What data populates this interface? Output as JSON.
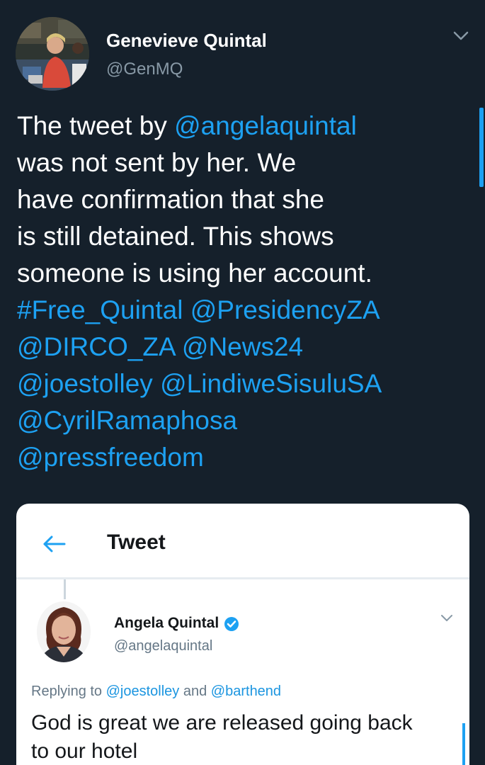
{
  "tweet": {
    "author": {
      "name": "Genevieve Quintal",
      "handle": "@GenMQ"
    },
    "caret_icon": "chevron-down-icon",
    "text_lines": [
      [
        {
          "t": "The tweet by ",
          "link": false
        },
        {
          "t": "@angelaquintal",
          "link": true
        }
      ],
      [
        {
          "t": "was not sent by her. We",
          "link": false
        }
      ],
      [
        {
          "t": "have confirmation that she",
          "link": false
        }
      ],
      [
        {
          "t": "is still detained. This shows",
          "link": false
        }
      ],
      [
        {
          "t": "someone is using her account.",
          "link": false
        }
      ],
      [
        {
          "t": "#Free_Quintal",
          "link": true
        },
        {
          "t": " ",
          "link": false
        },
        {
          "t": "@PresidencyZA",
          "link": true
        }
      ],
      [
        {
          "t": "@DIRCO_ZA",
          "link": true
        },
        {
          "t": " ",
          "link": false
        },
        {
          "t": "@News24",
          "link": true
        }
      ],
      [
        {
          "t": "@joestolley",
          "link": true
        },
        {
          "t": " ",
          "link": false
        },
        {
          "t": "@LindiweSisuluSA",
          "link": true
        }
      ],
      [
        {
          "t": "@CyrilRamaphosa",
          "link": true
        }
      ],
      [
        {
          "t": "@pressfreedom",
          "link": true
        }
      ]
    ]
  },
  "embedded_screenshot": {
    "header": {
      "back_icon": "back-arrow-icon",
      "title": "Tweet"
    },
    "quoted_tweet": {
      "name": "Angela Quintal",
      "verified_icon": "verified-badge-icon",
      "handle": "@angelaquintal",
      "caret_icon": "chevron-down-icon",
      "replying_prefix": "Replying to ",
      "replying_user1": "@joestolley",
      "replying_and": " and ",
      "replying_user2": "@barthend",
      "text_lines": [
        "God is great we are released going back",
        "to our hotel"
      ]
    }
  },
  "colors": {
    "background": "#15202b",
    "link": "#1da1f2",
    "secondary_text": "#8899a6"
  }
}
